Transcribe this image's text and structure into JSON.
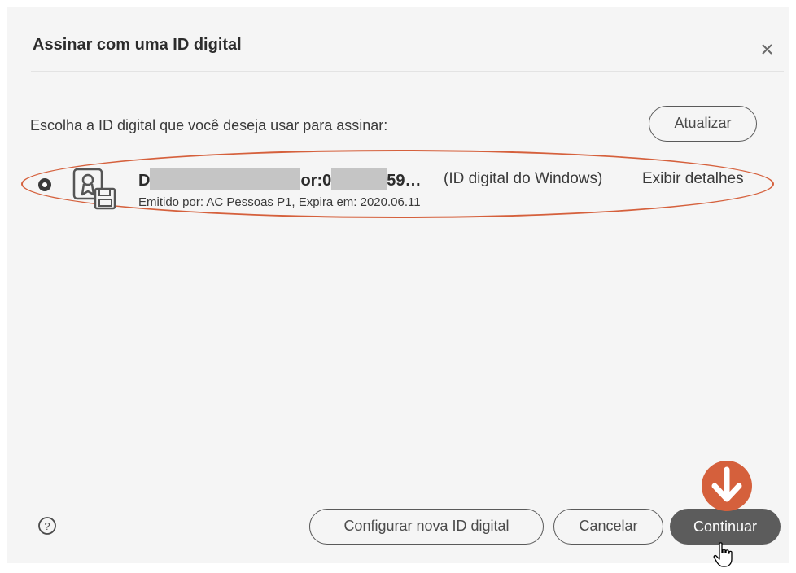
{
  "dialog": {
    "title": "Assinar com uma ID digital",
    "close_icon": "close-icon"
  },
  "content": {
    "prompt": "Escolha a ID digital que você deseja usar para assinar:",
    "refresh_label": "Atualizar"
  },
  "digital_id": {
    "selected": true,
    "icon": "certificate-icon",
    "name_start": "D",
    "name_middle": "or:0",
    "name_end": "59…",
    "type": "(ID digital do Windows)",
    "details_link": "Exibir detalhes",
    "issuer_info": "Emitido por: AC Pessoas P1, Expira em: 2020.06.11"
  },
  "footer": {
    "help_icon": "help-icon",
    "configure_label": "Configurar nova ID digital",
    "cancel_label": "Cancelar",
    "continue_label": "Continuar"
  },
  "annotation": {
    "arrow_icon": "arrow-down-icon",
    "cursor_icon": "hand-cursor-icon",
    "accent_color": "#d5603c"
  },
  "colors": {
    "dialog_bg": "#f5f5f5",
    "primary_button": "#5c5c5c",
    "text": "#3a3a3a"
  }
}
